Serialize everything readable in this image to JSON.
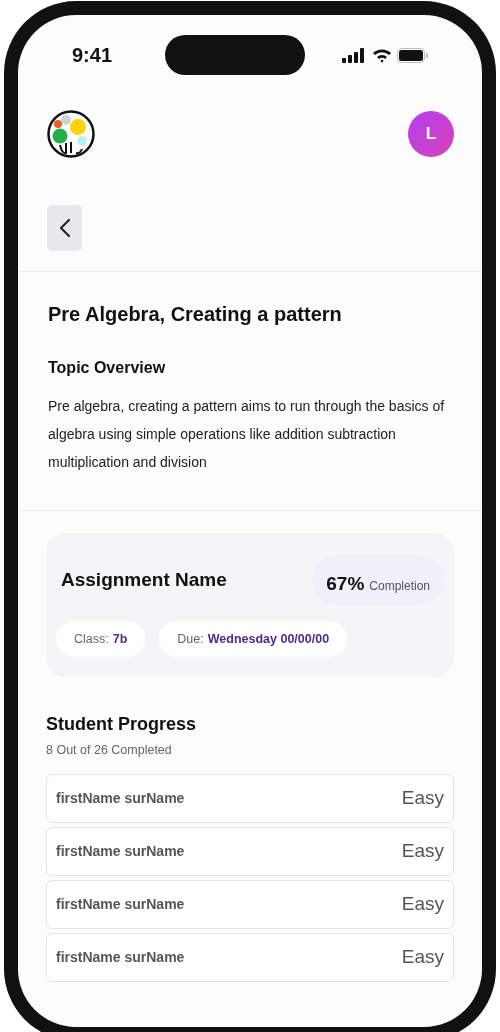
{
  "status_bar": {
    "time": "9:41"
  },
  "header": {
    "avatar_initial": "L"
  },
  "topic": {
    "title": "Pre Algebra, Creating a pattern",
    "overview_heading": "Topic Overview",
    "description": "Pre algebra, creating a pattern aims to run through the basics of algebra using simple operations like addition subtraction multiplication and division"
  },
  "assignment": {
    "name": "Assignment Name",
    "completion_value": "67%",
    "completion_label": "Completion",
    "class_label": "Class:",
    "class_value": "7b",
    "due_label": "Due:",
    "due_value": "Wednesday 00/00/00"
  },
  "progress": {
    "title": "Student Progress",
    "summary": "8 Out of 26 Completed",
    "students": [
      {
        "name": "firstName surName",
        "difficulty": "Easy"
      },
      {
        "name": "firstName surName",
        "difficulty": "Easy"
      },
      {
        "name": "firstName surName",
        "difficulty": "Easy"
      },
      {
        "name": "firstName surName",
        "difficulty": "Easy"
      }
    ]
  }
}
